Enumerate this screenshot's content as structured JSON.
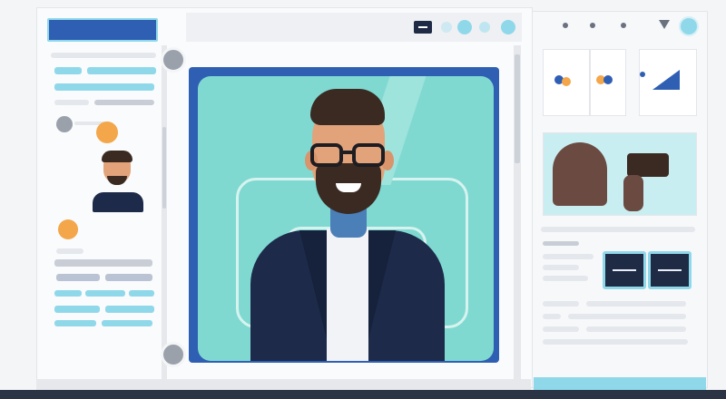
{
  "theme": {
    "background": "#f4f5f7",
    "panel": "#ffffff",
    "accent_blue": "#2f5fb3",
    "accent_cyan": "#8fd8ea",
    "accent_orange": "#f4a64a",
    "portrait_bg": "#7fd9d1",
    "suit_navy": "#1d2a4a"
  },
  "icons": {
    "top_toolbar": [
      "message-icon",
      "circle-button-icon",
      "circle-button-icon",
      "circle-button-icon"
    ],
    "right_toolbar": [
      "dot-icon",
      "dot-icon",
      "dot-icon",
      "chevron-down-icon",
      "circle-button-icon"
    ],
    "media": [
      "video-call-icon",
      "camera-icon",
      "photo-icon"
    ]
  }
}
